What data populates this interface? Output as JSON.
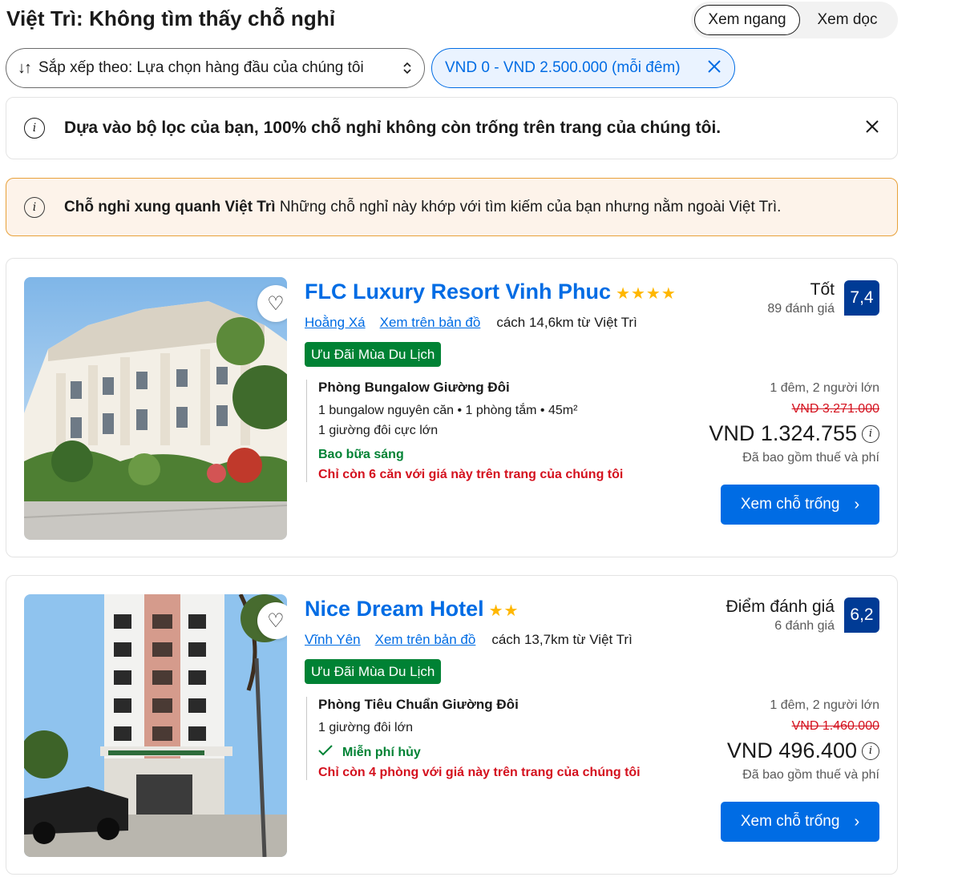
{
  "page_title": "Việt Trì: Không tìm thấy chỗ nghỉ",
  "view_toggle": {
    "horizontal": "Xem ngang",
    "vertical": "Xem dọc"
  },
  "sort": {
    "label": "Sắp xếp theo: Lựa chọn hàng đầu của chúng tôi",
    "icon": "sort-arrows-icon"
  },
  "price_filter": {
    "label": "VND 0 - VND 2.500.000 (mỗi đêm)"
  },
  "info_banner": {
    "text": "Dựa vào bộ lọc của bạn, 100% chỗ nghỉ không còn trống trên trang của chúng tôi."
  },
  "nearby_banner": {
    "title": "Chỗ nghỉ xung quanh Việt Trì",
    "text": "Những chỗ nghỉ này khớp với tìm kiếm của bạn nhưng nằm ngoài Việt Trì."
  },
  "colors": {
    "brand_blue": "#006ce4",
    "score_blue": "#003b95",
    "deal_green": "#008234",
    "alert_red": "#d4111e",
    "star_yellow": "#ffb700",
    "warn_bg": "#fdf3ea",
    "warn_border": "#e8a13a"
  },
  "hotels": [
    {
      "name": "FLC Luxury Resort Vinh Phuc",
      "stars": "★★★★",
      "area": "Hoằng Xá",
      "map_link": "Xem trên bản đồ",
      "distance": "cách 14,6km từ Việt Trì",
      "deal": "Ưu Đãi Mùa Du Lịch",
      "score_word": "Tốt",
      "review_count": "89 đánh giá",
      "score": "7,4",
      "room_name": "Phòng Bungalow Giường Đôi",
      "room_details": "1 bungalow nguyên căn • 1 phòng tắm • 45m²",
      "bed": "1 giường đôi cực lớn",
      "perk": "Bao bữa sáng",
      "scarcity": "Chỉ còn 6 căn với giá này trên trang của chúng tôi",
      "stay": "1 đêm, 2 người lớn",
      "old_price": "VND 3.271.000",
      "price": "VND 1.324.755",
      "tax_note": "Đã bao gồm thuế và phí",
      "cta": "Xem chỗ trống"
    },
    {
      "name": "Nice Dream Hotel",
      "stars": "★★",
      "area": "Vĩnh Yên",
      "map_link": "Xem trên bản đồ",
      "distance": "cách 13,7km từ Việt Trì",
      "deal": "Ưu Đãi Mùa Du Lịch",
      "score_word": "Điểm đánh giá",
      "review_count": "6 đánh giá",
      "score": "6,2",
      "room_name": "Phòng Tiêu Chuẩn Giường Đôi",
      "bed": "1 giường đôi lớn",
      "perk": "Miễn phí hủy",
      "scarcity": "Chỉ còn 4 phòng với giá này trên trang của chúng tôi",
      "stay": "1 đêm, 2 người lớn",
      "old_price": "VND 1.460.000",
      "price": "VND 496.400",
      "tax_note": "Đã bao gồm thuế và phí",
      "cta": "Xem chỗ trống"
    }
  ]
}
